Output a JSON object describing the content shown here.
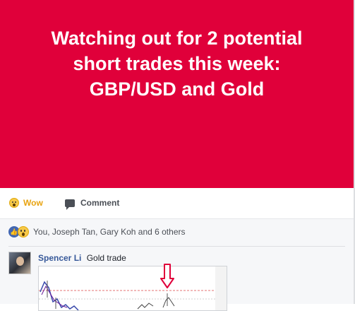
{
  "banner": {
    "line1": "Watching out for 2 potential",
    "line2": "short trades this week:",
    "line3": "GBP/USD and Gold"
  },
  "actions": {
    "wow_label": "Wow",
    "comment_label": "Comment"
  },
  "reactions": {
    "summary": "You, Joseph Tan, Gary Koh and 6 others"
  },
  "comment": {
    "author": "Spencer Li",
    "text": "Gold trade"
  },
  "colors": {
    "banner_bg": "#e0003a",
    "wow": "#e8a310",
    "link": "#365899",
    "arrow": "#e0003a"
  },
  "icons": [
    "wow-emoji-icon",
    "comment-icon",
    "like-icon"
  ]
}
